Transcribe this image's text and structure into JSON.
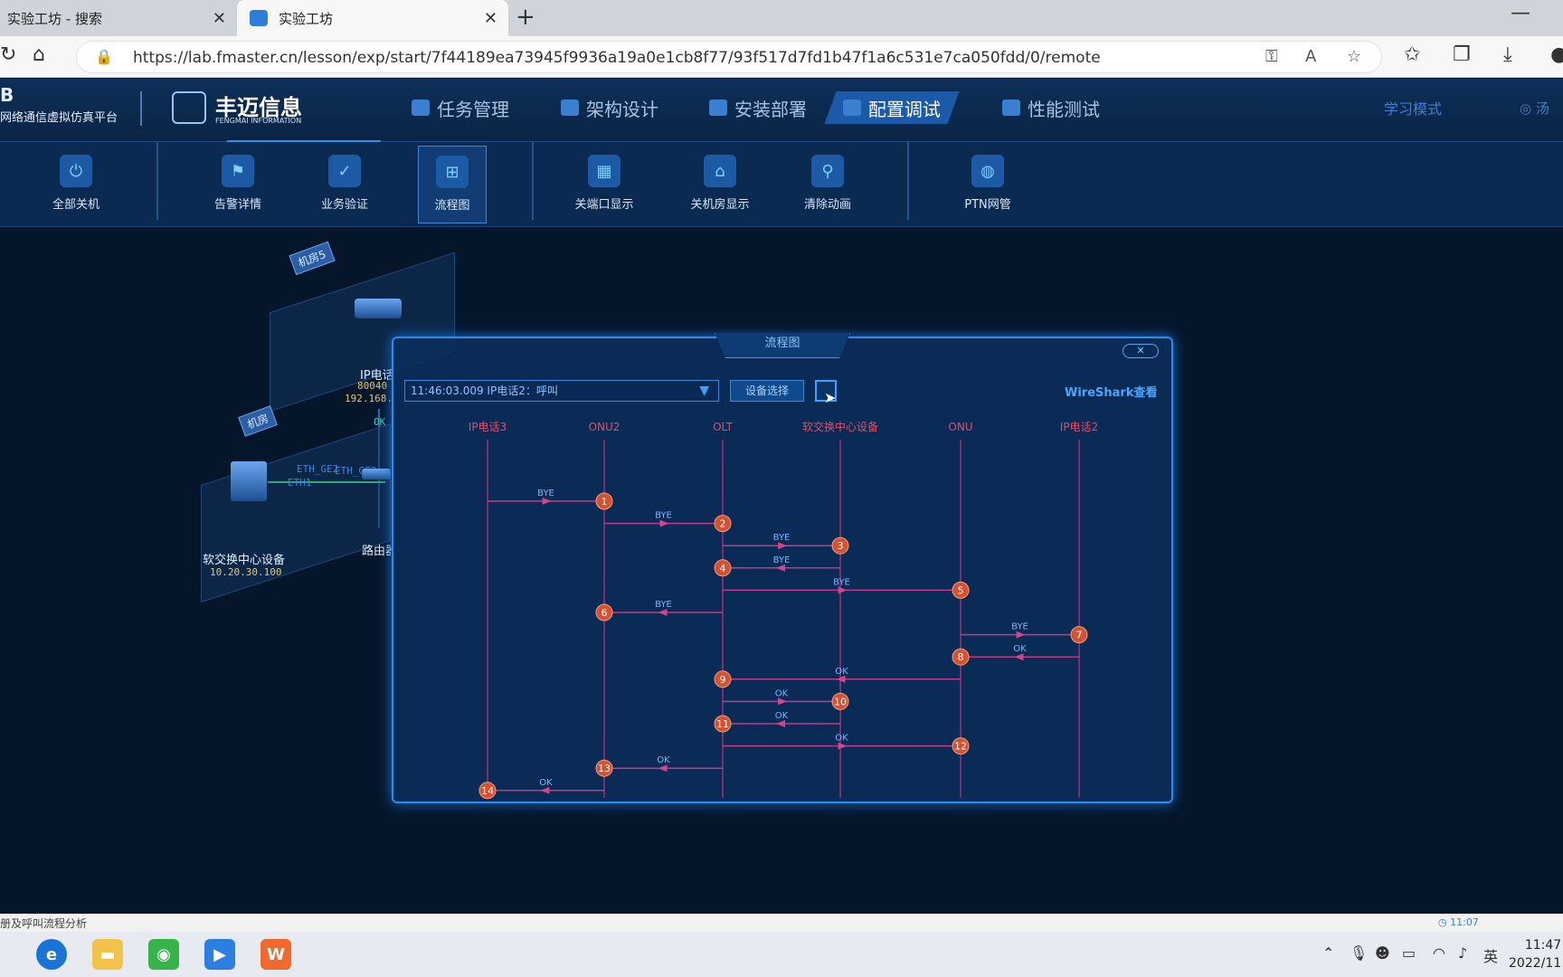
{
  "browser": {
    "tabs": [
      {
        "title": "实验工坊 - 搜索",
        "close": "✕"
      },
      {
        "title": "实验工坊",
        "close": "✕"
      }
    ],
    "new_tab": "+",
    "minimize": "—",
    "url": "https://lab.fmaster.cn/lesson/exp/start/7f44189ea73945f9936a19a0e1cb8f77/93f517d7fd1b47f1a6c531e7ca050fdd/0/remote"
  },
  "app": {
    "brand_short": "B",
    "brand_sub": "网络通信虚拟仿真平台",
    "logo_cn": "丰迈信息",
    "logo_en": "FENGMAI INFORMATION",
    "nav": [
      "任务管理",
      "架构设计",
      "安装部署",
      "配置调试",
      "性能测试"
    ],
    "nav_active": "配置调试",
    "study_mode": "学习模式",
    "user": "汤"
  },
  "toolbar": {
    "items": [
      "全部关机",
      "告警详情",
      "业务验证",
      "流程图",
      "关端口显示",
      "关机房显示",
      "清除动画",
      "PTN网管"
    ],
    "selected": "流程图"
  },
  "topology": {
    "room5": "机房5",
    "room": "机房",
    "phone_label": "IP电话",
    "phone_num": "80040",
    "phone_ip": "192.168.",
    "ok": "OK",
    "eth_ge3": "ETH_GE3",
    "eth_ge2": "ETH_GE2",
    "eth1": "ETH1",
    "softswitch": "软交换中心设备",
    "softswitch_ip": "10.20.30.100",
    "router": "路由器"
  },
  "modal": {
    "title": "流程图",
    "close": "✕",
    "select_value": "11:46:03.009 IP电话2：呼叫",
    "device_button": "设备选择",
    "wireshark": "WireShark查看",
    "columns": [
      "IP电话3",
      "ONU2",
      "OLT",
      "软交换中心设备",
      "ONU",
      "IP电话2"
    ],
    "messages": [
      {
        "step": 1,
        "label": "BYE",
        "from": "IP电话3",
        "to": "ONU2"
      },
      {
        "step": 2,
        "label": "BYE",
        "from": "ONU2",
        "to": "OLT"
      },
      {
        "step": 3,
        "label": "BYE",
        "from": "OLT",
        "to": "软交换中心设备"
      },
      {
        "step": 4,
        "label": "BYE",
        "from": "软交换中心设备",
        "to": "OLT"
      },
      {
        "step": 5,
        "label": "BYE",
        "from": "OLT",
        "to": "ONU"
      },
      {
        "step": 6,
        "label": "BYE",
        "from": "OLT",
        "to": "ONU2"
      },
      {
        "step": 7,
        "label": "BYE",
        "from": "ONU",
        "to": "IP电话2"
      },
      {
        "step": 8,
        "label": "OK",
        "from": "IP电话2",
        "to": "ONU"
      },
      {
        "step": 9,
        "label": "OK",
        "from": "ONU",
        "to": "OLT"
      },
      {
        "step": 10,
        "label": "OK",
        "from": "OLT",
        "to": "软交换中心设备"
      },
      {
        "step": 11,
        "label": "OK",
        "from": "软交换中心设备",
        "to": "OLT"
      },
      {
        "step": 12,
        "label": "OK",
        "from": "OLT",
        "to": "ONU"
      },
      {
        "step": 13,
        "label": "OK",
        "from": "OLT",
        "to": "ONU2"
      },
      {
        "step": 14,
        "label": "OK",
        "from": "ONU2",
        "to": "IP电话3"
      }
    ]
  },
  "status": {
    "left": "册及呼叫流程分析",
    "timer": "11:07"
  },
  "taskbar": {
    "ime": "英",
    "time": "11:47",
    "date": "2022/11"
  }
}
